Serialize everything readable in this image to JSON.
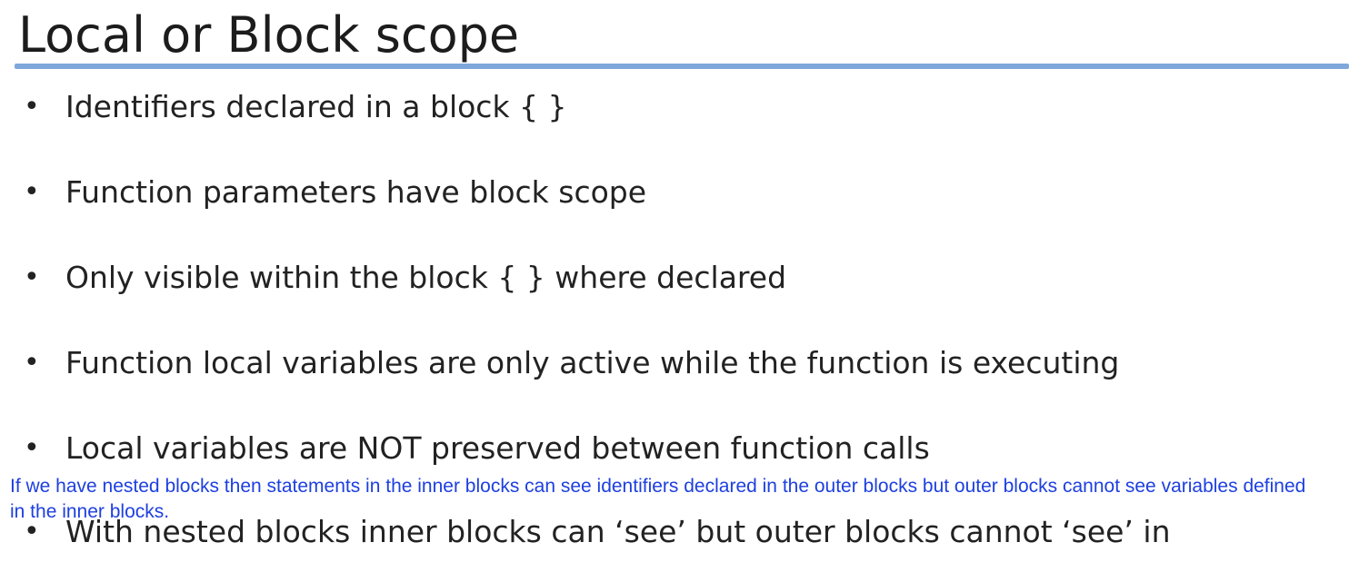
{
  "slide": {
    "title": "Local or Block scope",
    "bullet_glyph": "•",
    "bullets": [
      "Identifiers declared in a block { }",
      "Function parameters have block scope",
      "Only visible within the block { } where declared",
      "Function local variables are only active while the function is executing",
      "Local variables are NOT preserved between function calls",
      "With nested blocks inner blocks can ‘see’ but outer blocks cannot ‘see’ in"
    ]
  },
  "caption": {
    "text": "If we have nested blocks then statements in the inner blocks can see identifiers declared in the outer blocks but outer blocks cannot see variables defined in the inner blocks."
  },
  "colors": {
    "title_rule": "#7ea8dc",
    "caption_text": "#1d3fe0",
    "body_text": "#222222"
  }
}
